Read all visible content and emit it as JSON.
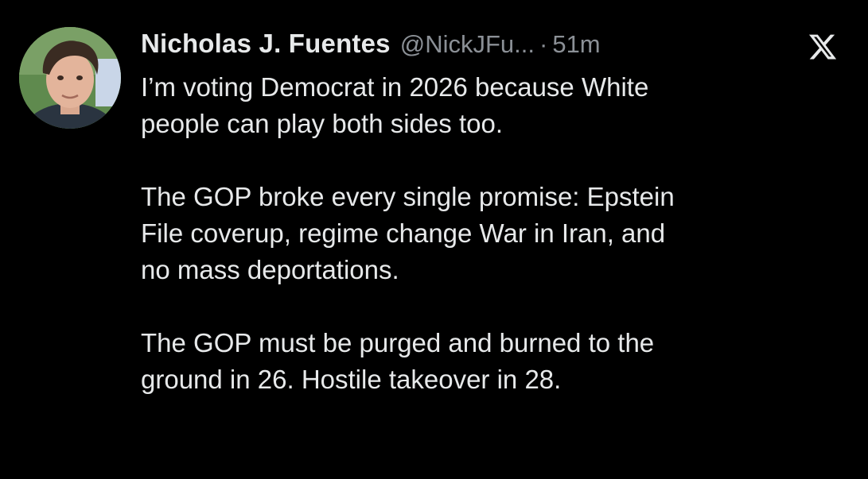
{
  "author": {
    "display_name": "Nicholas J. Fuentes",
    "handle": "@NickJFu...",
    "separator": "·",
    "timestamp": "51m",
    "avatar_icon": "profile-photo"
  },
  "platform": {
    "logo_icon": "x-logo-icon"
  },
  "tweet": {
    "paragraphs": [
      {
        "lines": [
          "I’m voting Democrat in 2026 because White",
          "people can play both sides too."
        ]
      },
      {
        "lines": [
          "The GOP broke every single promise: Epstein",
          "File coverup, regime change War in Iran, and",
          "no mass deportations."
        ]
      },
      {
        "lines": [
          "The GOP must be purged and burned to the",
          "ground in 26. Hostile takeover in 28."
        ]
      }
    ]
  },
  "colors": {
    "background": "#000000",
    "primary_text": "#e7e9ea",
    "secondary_text": "#8b9096"
  }
}
